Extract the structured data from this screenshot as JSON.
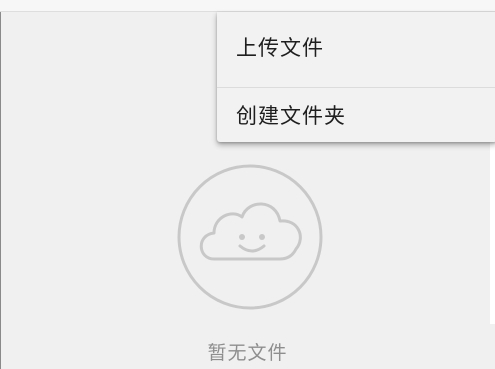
{
  "menu": {
    "items": [
      {
        "label": "上传文件"
      },
      {
        "label": "创建文件夹"
      }
    ]
  },
  "empty_state": {
    "icon": "smiling-cloud-icon",
    "text": "暂无文件"
  },
  "colors": {
    "panel_background": "#f0f0f0",
    "menu_background": "#f2f2f2",
    "icon_stroke": "#c8c8c8",
    "empty_text": "#8e8e8e"
  }
}
